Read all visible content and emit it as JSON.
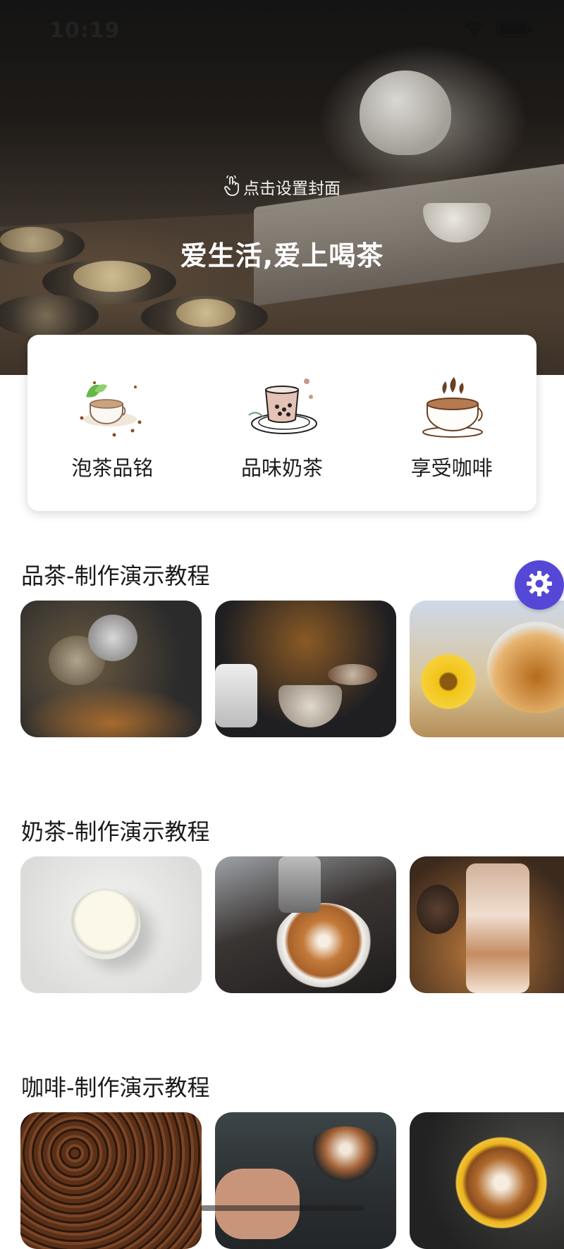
{
  "status_bar": {
    "time": "10:19"
  },
  "hero": {
    "cover_hint": "点击设置封面",
    "title": "爱生活,爱上喝茶"
  },
  "categories": [
    {
      "label": "泡茶品铭",
      "icon": "tea-cup-icon"
    },
    {
      "label": "品味奶茶",
      "icon": "bubble-milk-tea-icon"
    },
    {
      "label": "享受咖啡",
      "icon": "coffee-cup-icon"
    }
  ],
  "sections": [
    {
      "title": "品茶-制作演示教程"
    },
    {
      "title": "奶茶-制作演示教程"
    },
    {
      "title": "咖啡-制作演示教程"
    }
  ],
  "floating_button": {
    "icon": "gear-icon",
    "color": "#5548d6"
  }
}
